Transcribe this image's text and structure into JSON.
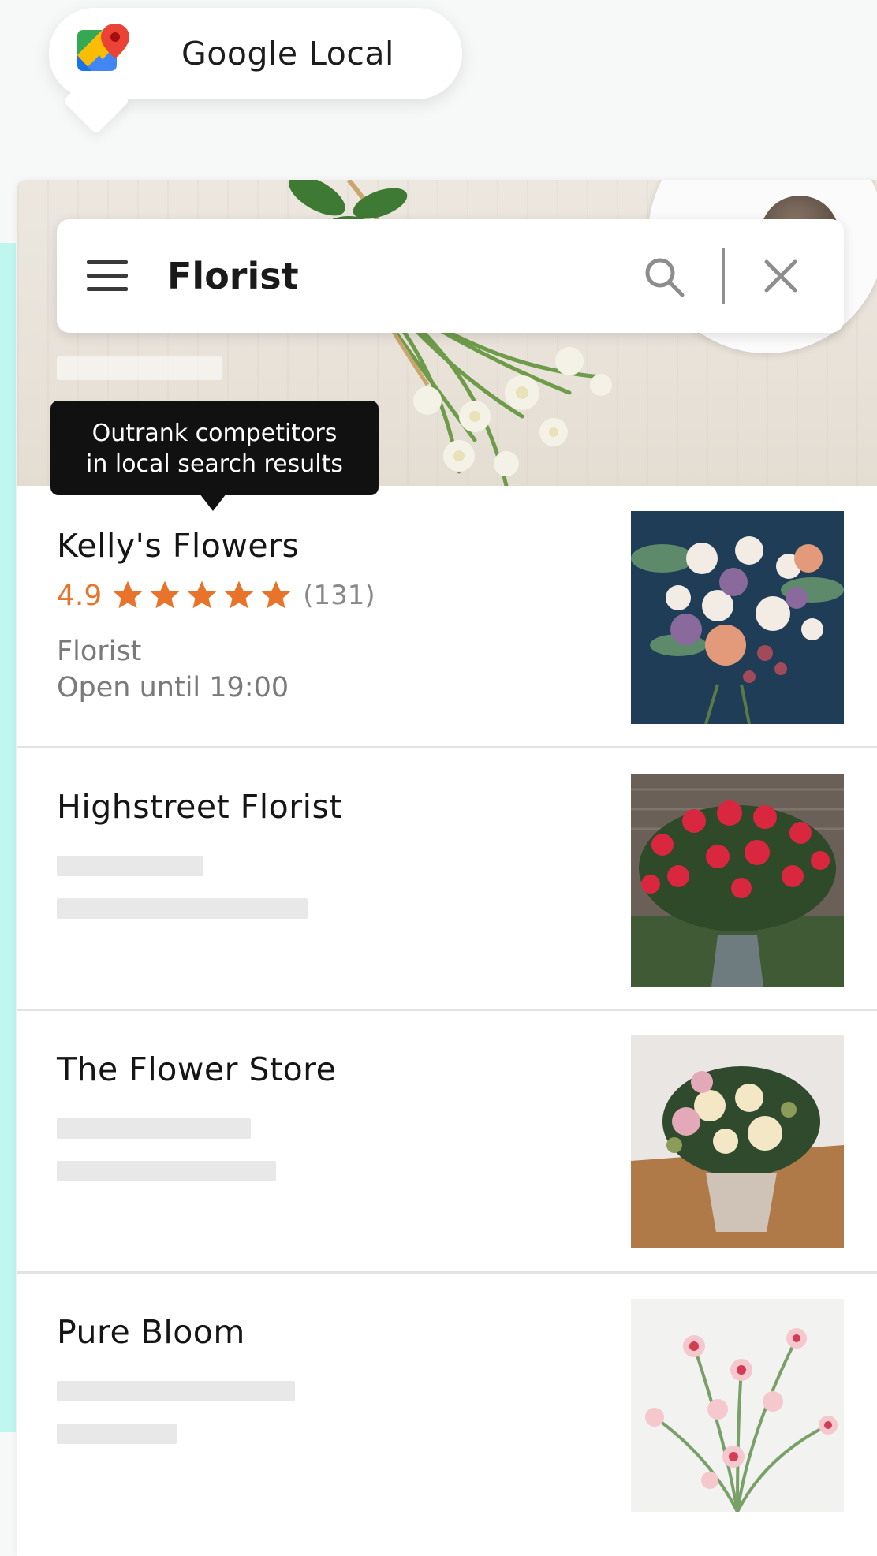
{
  "badge": {
    "title": "Google Local"
  },
  "search": {
    "query": "Florist"
  },
  "tooltip": {
    "line1": "Outrank competitors",
    "line2": "in local search results"
  },
  "listings": [
    {
      "name": "Kelly's Flowers",
      "rating": "4.9",
      "stars": 5,
      "reviews": "(131)",
      "category": "Florist",
      "hours": "Open until 19:00"
    },
    {
      "name": "Highstreet Florist"
    },
    {
      "name": "The Flower Store"
    },
    {
      "name": "Pure Bloom"
    }
  ],
  "colors": {
    "accent": "#e8742b",
    "teal": "#bff6ef",
    "tooltip_bg": "#111111"
  }
}
